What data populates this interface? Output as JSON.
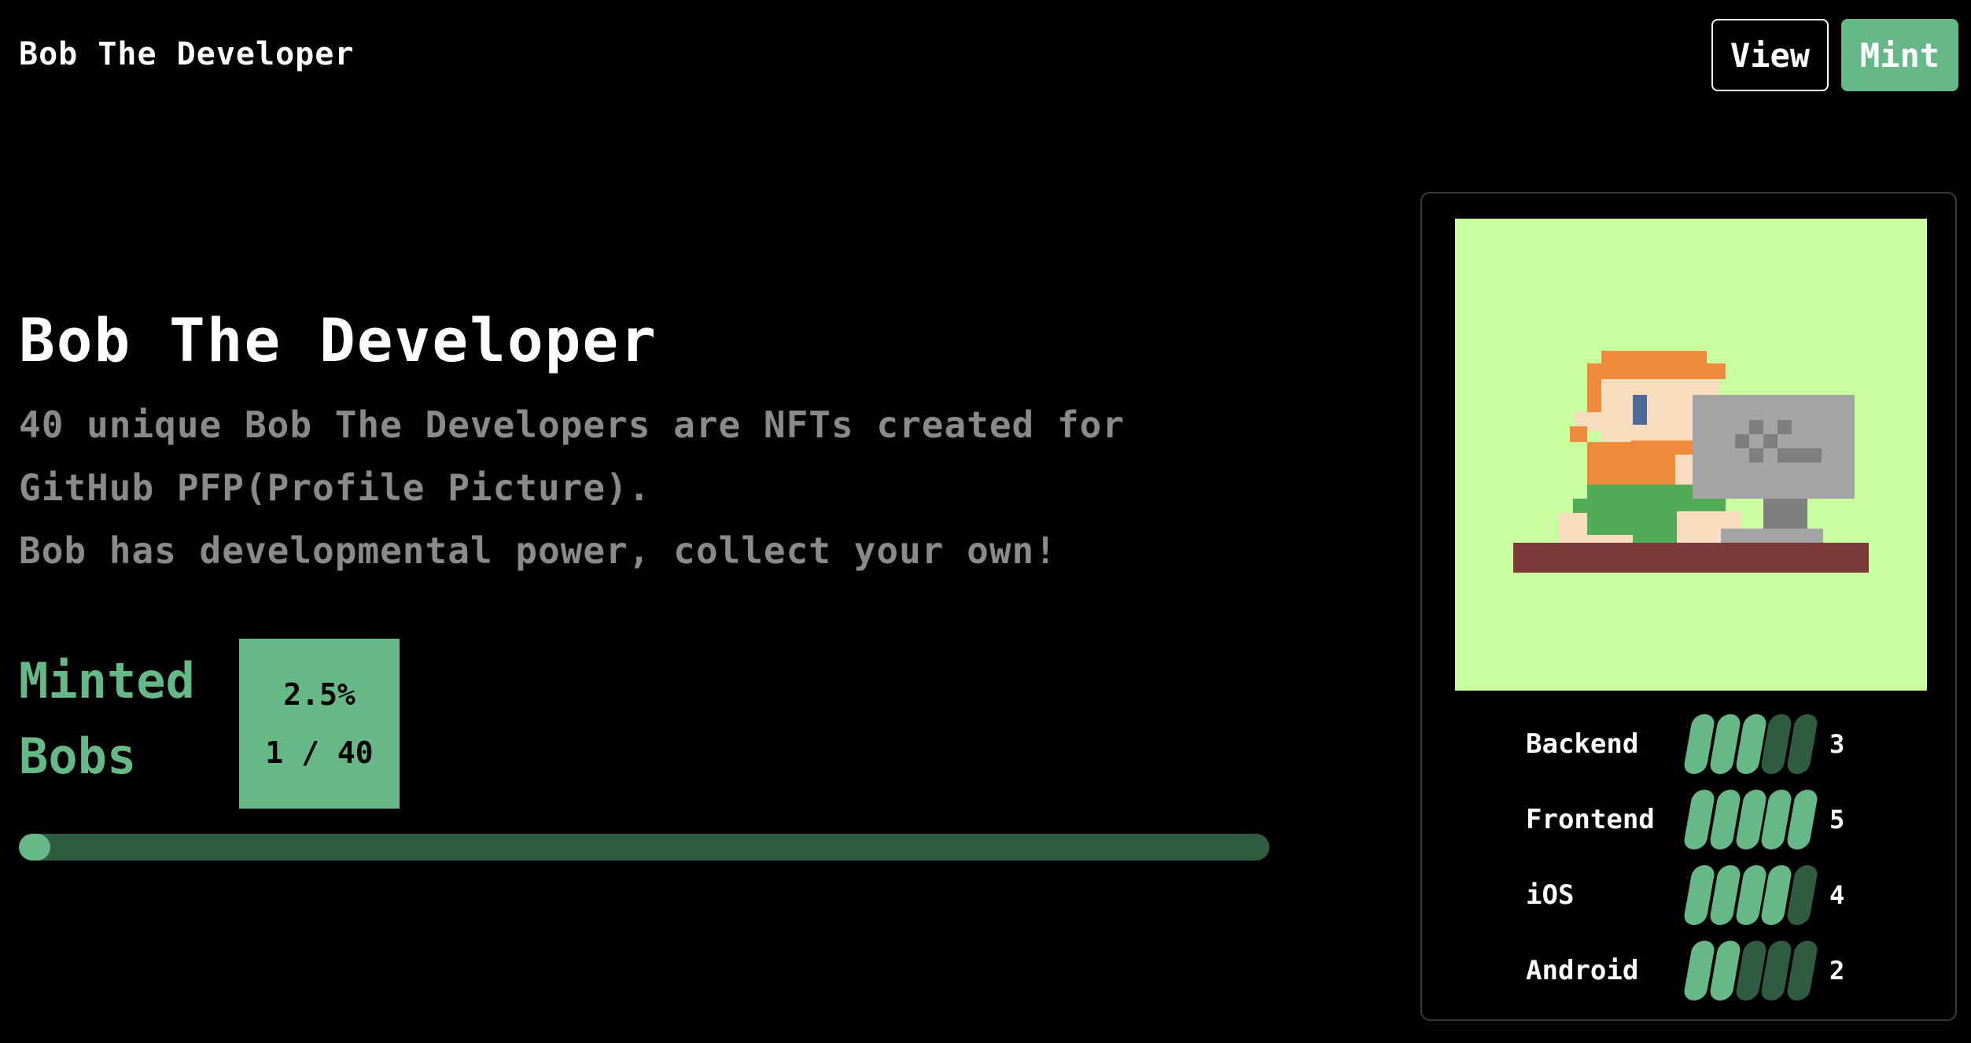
{
  "header": {
    "brand": "Bob The Developer",
    "view_label": "View",
    "mint_label": "Mint"
  },
  "hero": {
    "title": "Bob The Developer",
    "description_line1": "40 unique Bob The Developers are NFTs created for",
    "description_line2": "GitHub PFP(Profile Picture).",
    "description_line3": "Bob has developmental power, collect your own!"
  },
  "minted": {
    "label_line1": "Minted",
    "label_line2": "Bobs",
    "percent": "2.5%",
    "count": "1 / 40",
    "progress_fraction": 0.025
  },
  "card": {
    "stats": [
      {
        "label": "Backend",
        "value": "3",
        "level": 3,
        "max": 5
      },
      {
        "label": "Frontend",
        "value": "5",
        "level": 5,
        "max": 5
      },
      {
        "label": "iOS",
        "value": "4",
        "level": 4,
        "max": 5
      },
      {
        "label": "Android",
        "value": "2",
        "level": 2,
        "max": 5
      }
    ]
  },
  "colors": {
    "accent": "#66b886",
    "accent_dark": "#2f5b40",
    "portrait_bg": "#caffa0",
    "desc_text": "#8a8a8a"
  },
  "icons": {
    "portrait": "pixel-bob-developer-portrait"
  }
}
